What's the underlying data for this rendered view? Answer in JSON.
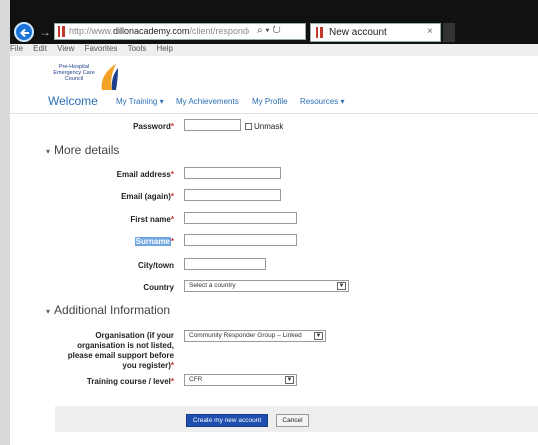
{
  "browser": {
    "url_prefix": "http://www.",
    "url_domain": "dillonacademy.com",
    "url_suffix": "/client/responder/log",
    "url_icons": "⌕ ▾ ↻",
    "tab_title": "New account",
    "tab_close": "×",
    "forward": "→"
  },
  "menubar": [
    "File",
    "Edit",
    "View",
    "Favorites",
    "Tools",
    "Help"
  ],
  "logo": {
    "lines": [
      "Pre-Hospital",
      "Emergency Care",
      "Council"
    ]
  },
  "nav": {
    "welcome": "Welcome",
    "items": [
      "My Training ▾",
      "My Achievements",
      "My Profile",
      "Resources ▾"
    ]
  },
  "form": {
    "password_label": "Password",
    "unmask_label": "Unmask",
    "required_mark": "*",
    "more_details": "More details",
    "email_label": "Email address",
    "email_again_label": "Email (again)",
    "first_name_label": "First name",
    "surname_label": "Surname",
    "city_label": "City/town",
    "country_label": "Country",
    "country_value": "Select a country",
    "additional_info": "Additional Information",
    "organisation_label": [
      "Organisation (if your",
      "organisation is not listed,",
      "please email support before",
      "you register)"
    ],
    "organisation_value": "Community Responder Group – Linked",
    "training_label": "Training course / level",
    "training_value": "CFR",
    "create_button": "Create my new account",
    "cancel_button": "Cancel",
    "section_toggle": "▾",
    "dropdown_arrow": "▼"
  }
}
